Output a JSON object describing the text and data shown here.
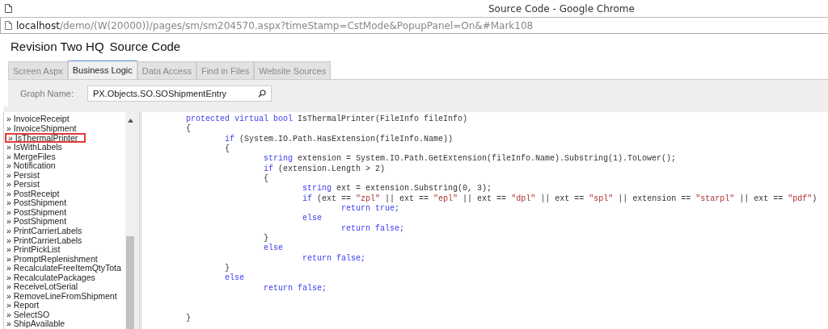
{
  "window": {
    "title": "Source Code - Google Chrome"
  },
  "address_bar": {
    "host": "localhost",
    "path": "/demo/(W(20000))/pages/sm/sm204570.aspx?timeStamp=CstMode&PopupPanel=On&#Mark108"
  },
  "page": {
    "company": "Revision Two HQ",
    "title": "Source Code"
  },
  "tabs": [
    {
      "label": "Screen Aspx",
      "selected": false
    },
    {
      "label": "Business Logic",
      "selected": true
    },
    {
      "label": "Data Access",
      "selected": false
    },
    {
      "label": "Find in Files",
      "selected": false
    },
    {
      "label": "Website Sources",
      "selected": false
    }
  ],
  "graph_name": {
    "label": "Graph Name:",
    "value": "PX.Objects.SO.SOShipmentEntry"
  },
  "members": [
    {
      "marker": "»",
      "name": "InvoiceReceipt",
      "highlighted": false
    },
    {
      "marker": "»",
      "name": "InvoiceShipment",
      "highlighted": false
    },
    {
      "marker": "»",
      "name": "IsThermalPrinter",
      "highlighted": true
    },
    {
      "marker": "»",
      "name": "IsWithLabels",
      "highlighted": false
    },
    {
      "marker": "»",
      "name": "MergeFiles",
      "highlighted": false
    },
    {
      "marker": "»",
      "name": "Notification",
      "highlighted": false
    },
    {
      "marker": "»",
      "name": "Persist",
      "highlighted": false
    },
    {
      "marker": "»",
      "name": "Persist",
      "highlighted": false
    },
    {
      "marker": "»",
      "name": "PostReceipt",
      "highlighted": false
    },
    {
      "marker": "»",
      "name": "PostShipment",
      "highlighted": false
    },
    {
      "marker": "»",
      "name": "PostShipment",
      "highlighted": false
    },
    {
      "marker": "»",
      "name": "PostShipment",
      "highlighted": false
    },
    {
      "marker": "»",
      "name": "PrintCarrierLabels",
      "highlighted": false
    },
    {
      "marker": "»",
      "name": "PrintCarrierLabels",
      "highlighted": false
    },
    {
      "marker": "»",
      "name": "PrintPickList",
      "highlighted": false
    },
    {
      "marker": "»",
      "name": "PromptReplenishment",
      "highlighted": false
    },
    {
      "marker": "»",
      "name": "RecalculateFreeItemQtyTota",
      "highlighted": false
    },
    {
      "marker": "»",
      "name": "RecalculatePackages",
      "highlighted": false
    },
    {
      "marker": "»",
      "name": "ReceiveLotSerial",
      "highlighted": false
    },
    {
      "marker": "»",
      "name": "RemoveLineFromShipment",
      "highlighted": false
    },
    {
      "marker": "»",
      "name": "Report",
      "highlighted": false
    },
    {
      "marker": "»",
      "name": "SelectSO",
      "highlighted": false
    },
    {
      "marker": "»",
      "name": "ShipAvailable",
      "highlighted": false
    }
  ],
  "code_lines": [
    {
      "kind": "code",
      "tokens": [
        {
          "kind": "keyword",
          "text": "protected virtual bool "
        },
        {
          "kind": "plain",
          "text": "IsThermalPrinter(FileInfo fileInfo)"
        }
      ]
    },
    {
      "kind": "code",
      "tokens": [
        {
          "kind": "plain",
          "text": "{"
        }
      ]
    },
    {
      "kind": "code",
      "tokens": [
        {
          "kind": "keyword",
          "text": "\tif "
        },
        {
          "kind": "plain",
          "text": "(System.IO.Path.HasExtension(fileInfo.Name))"
        }
      ]
    },
    {
      "kind": "code",
      "tokens": [
        {
          "kind": "plain",
          "text": "\t{"
        }
      ]
    },
    {
      "kind": "code",
      "tokens": [
        {
          "kind": "keyword",
          "text": "\t\tstring "
        },
        {
          "kind": "plain",
          "text": "extension = System.IO.Path.GetExtension(fileInfo.Name).Substring(1).ToLower();"
        }
      ]
    },
    {
      "kind": "code",
      "tokens": [
        {
          "kind": "keyword",
          "text": "\t\tif "
        },
        {
          "kind": "plain",
          "text": "(extension.Length > 2)"
        }
      ]
    },
    {
      "kind": "code",
      "tokens": [
        {
          "kind": "plain",
          "text": "\t\t{"
        }
      ]
    },
    {
      "kind": "code",
      "tokens": [
        {
          "kind": "keyword",
          "text": "\t\t\tstring "
        },
        {
          "kind": "plain",
          "text": "ext = extension.Substring(0, 3);"
        }
      ]
    },
    {
      "kind": "code",
      "tokens": [
        {
          "kind": "keyword",
          "text": "\t\t\tif "
        },
        {
          "kind": "plain",
          "text": "(ext == "
        },
        {
          "kind": "string",
          "text": "\"zpl\""
        },
        {
          "kind": "plain",
          "text": " || ext == "
        },
        {
          "kind": "string",
          "text": "\"epl\""
        },
        {
          "kind": "plain",
          "text": " || ext == "
        },
        {
          "kind": "string",
          "text": "\"dpl\""
        },
        {
          "kind": "plain",
          "text": " || ext == "
        },
        {
          "kind": "string",
          "text": "\"spl\""
        },
        {
          "kind": "plain",
          "text": " || extension == "
        },
        {
          "kind": "string",
          "text": "\"starpl\""
        },
        {
          "kind": "plain",
          "text": " || ext == "
        },
        {
          "kind": "string",
          "text": "\"pdf\""
        },
        {
          "kind": "plain",
          "text": ")"
        }
      ]
    },
    {
      "kind": "code",
      "tokens": [
        {
          "kind": "keyword",
          "text": "\t\t\t\treturn true;"
        }
      ]
    },
    {
      "kind": "code",
      "tokens": [
        {
          "kind": "keyword",
          "text": "\t\t\telse"
        }
      ]
    },
    {
      "kind": "code",
      "tokens": [
        {
          "kind": "keyword",
          "text": "\t\t\t\treturn false;"
        }
      ]
    },
    {
      "kind": "code",
      "tokens": [
        {
          "kind": "plain",
          "text": "\t\t}"
        }
      ]
    },
    {
      "kind": "code",
      "tokens": [
        {
          "kind": "keyword",
          "text": "\t\telse"
        }
      ]
    },
    {
      "kind": "code",
      "tokens": [
        {
          "kind": "keyword",
          "text": "\t\t\treturn false;"
        }
      ]
    },
    {
      "kind": "code",
      "tokens": [
        {
          "kind": "plain",
          "text": "\t}"
        }
      ]
    },
    {
      "kind": "code",
      "tokens": [
        {
          "kind": "keyword",
          "text": "\telse"
        }
      ]
    },
    {
      "kind": "code",
      "tokens": [
        {
          "kind": "keyword",
          "text": "\t\treturn false;"
        }
      ]
    },
    {
      "kind": "blank"
    },
    {
      "kind": "blank"
    },
    {
      "kind": "code",
      "tokens": [
        {
          "kind": "plain",
          "text": "}"
        }
      ]
    }
  ]
}
